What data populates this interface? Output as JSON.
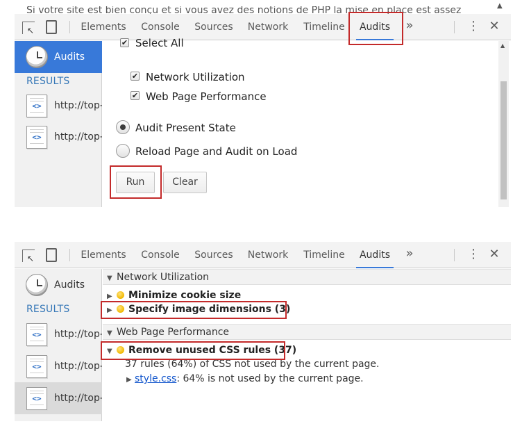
{
  "background_page": {
    "text": "Si votre site est bien conçu et si vous avez des notions de PHP la mise en place est assez"
  },
  "devtools": {
    "tabs": [
      "Elements",
      "Console",
      "Sources",
      "Network",
      "Timeline",
      "Audits"
    ],
    "overflow_label": "»",
    "active_tab": "Audits"
  },
  "sidebar": {
    "audits_label": "Audits",
    "results_label": "RESULTS",
    "top_results": [
      "http://top-",
      "http://top-"
    ],
    "bottom_results": [
      "http://top-",
      "http://top-",
      "http://top-"
    ]
  },
  "launcher": {
    "select_all": "Select All",
    "categories": [
      {
        "label": "Network Utilization",
        "checked": true
      },
      {
        "label": "Web Page Performance",
        "checked": true
      }
    ],
    "modes": [
      {
        "label": "Audit Present State",
        "selected": true
      },
      {
        "label": "Reload Page and Audit on Load",
        "selected": false
      }
    ],
    "run_label": "Run",
    "clear_label": "Clear"
  },
  "results": {
    "network_header": "Network Utilization",
    "network_items": [
      "Minimize cookie size",
      "Specify image dimensions (3)"
    ],
    "perf_header": "Web Page Performance",
    "perf_item": "Remove unused CSS rules (37)",
    "perf_detail": "37 rules (64%) of CSS not used by the current page.",
    "perf_file_link": "style.css",
    "perf_file_text": ": 64% is not used by the current page."
  },
  "colors": {
    "accent": "#3879d9",
    "highlight_box": "#c32a2a",
    "warning_dot": "#f1b800"
  }
}
